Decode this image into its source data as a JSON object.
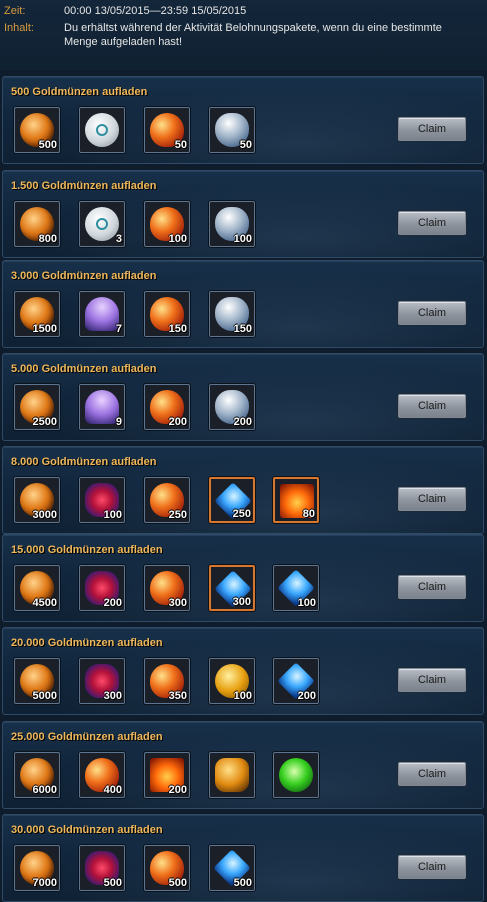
{
  "header": {
    "time_label": "Zeit:",
    "time_value": "00:00 13/05/2015—23:59 15/05/2015",
    "content_label": "Inhalt:",
    "content_value": "Du erhältst während der Aktivität Belohnungspakete, wenn du eine bestimmte Menge aufgeladen hast!"
  },
  "claim_label": "Claim",
  "tiers": [
    {
      "title": "500 Goldmünzen aufladen",
      "rewards": [
        {
          "icon": "coin-icon",
          "qty": "500"
        },
        {
          "icon": "egg-icon",
          "qty": ""
        },
        {
          "icon": "orb-icon",
          "qty": "50"
        },
        {
          "icon": "crystal-icon",
          "qty": "50"
        }
      ]
    },
    {
      "title": "1.500 Goldmünzen aufladen",
      "rewards": [
        {
          "icon": "coin-icon",
          "qty": "800"
        },
        {
          "icon": "egg-icon",
          "qty": "3"
        },
        {
          "icon": "orb-icon",
          "qty": "100"
        },
        {
          "icon": "crystal-icon",
          "qty": "100"
        }
      ]
    },
    {
      "title": "3.000 Goldmünzen aufladen",
      "rewards": [
        {
          "icon": "coin-icon",
          "qty": "1500"
        },
        {
          "icon": "jelly-icon",
          "qty": "7"
        },
        {
          "icon": "orb-icon",
          "qty": "150"
        },
        {
          "icon": "crystal-icon",
          "qty": "150"
        }
      ]
    },
    {
      "title": "5.000 Goldmünzen aufladen",
      "rewards": [
        {
          "icon": "coin-icon",
          "qty": "2500"
        },
        {
          "icon": "jelly-icon",
          "qty": "9"
        },
        {
          "icon": "orb-icon",
          "qty": "200"
        },
        {
          "icon": "crystal-icon",
          "qty": "200"
        }
      ]
    },
    {
      "title": "8.000 Goldmünzen aufladen",
      "rewards": [
        {
          "icon": "coin-icon",
          "qty": "3000"
        },
        {
          "icon": "red-orb-icon",
          "qty": "100"
        },
        {
          "icon": "orb-icon",
          "qty": "250"
        },
        {
          "icon": "blue-gem-icon",
          "qty": "250",
          "frame": "orange"
        },
        {
          "icon": "fire-scroll-icon",
          "qty": "80",
          "frame": "orange"
        }
      ]
    },
    {
      "title": "15.000 Goldmünzen aufladen",
      "rewards": [
        {
          "icon": "coin-icon",
          "qty": "4500"
        },
        {
          "icon": "red-orb-icon",
          "qty": "200"
        },
        {
          "icon": "orb-icon",
          "qty": "300"
        },
        {
          "icon": "blue-gem-icon",
          "qty": "300",
          "frame": "orange"
        },
        {
          "icon": "blue-gem-icon",
          "qty": "100"
        }
      ]
    },
    {
      "title": "20.000 Goldmünzen aufladen",
      "rewards": [
        {
          "icon": "coin-icon",
          "qty": "5000"
        },
        {
          "icon": "red-orb-icon",
          "qty": "300"
        },
        {
          "icon": "orb-icon",
          "qty": "350"
        },
        {
          "icon": "gold-coin-icon",
          "qty": "100"
        },
        {
          "icon": "blue-gem-icon",
          "qty": "200"
        }
      ]
    },
    {
      "title": "25.000 Goldmünzen aufladen",
      "rewards": [
        {
          "icon": "coin-icon",
          "qty": "6000"
        },
        {
          "icon": "orb-icon",
          "qty": "400"
        },
        {
          "icon": "fire-scroll-icon",
          "qty": "200"
        },
        {
          "icon": "amber-stone-icon",
          "qty": ""
        },
        {
          "icon": "emerald-icon",
          "qty": ""
        }
      ]
    },
    {
      "title": "30.000 Goldmünzen aufladen",
      "rewards": [
        {
          "icon": "coin-icon",
          "qty": "7000"
        },
        {
          "icon": "red-orb-icon",
          "qty": "500"
        },
        {
          "icon": "orb-icon",
          "qty": "500"
        },
        {
          "icon": "blue-gem-icon",
          "qty": "500"
        }
      ]
    }
  ]
}
